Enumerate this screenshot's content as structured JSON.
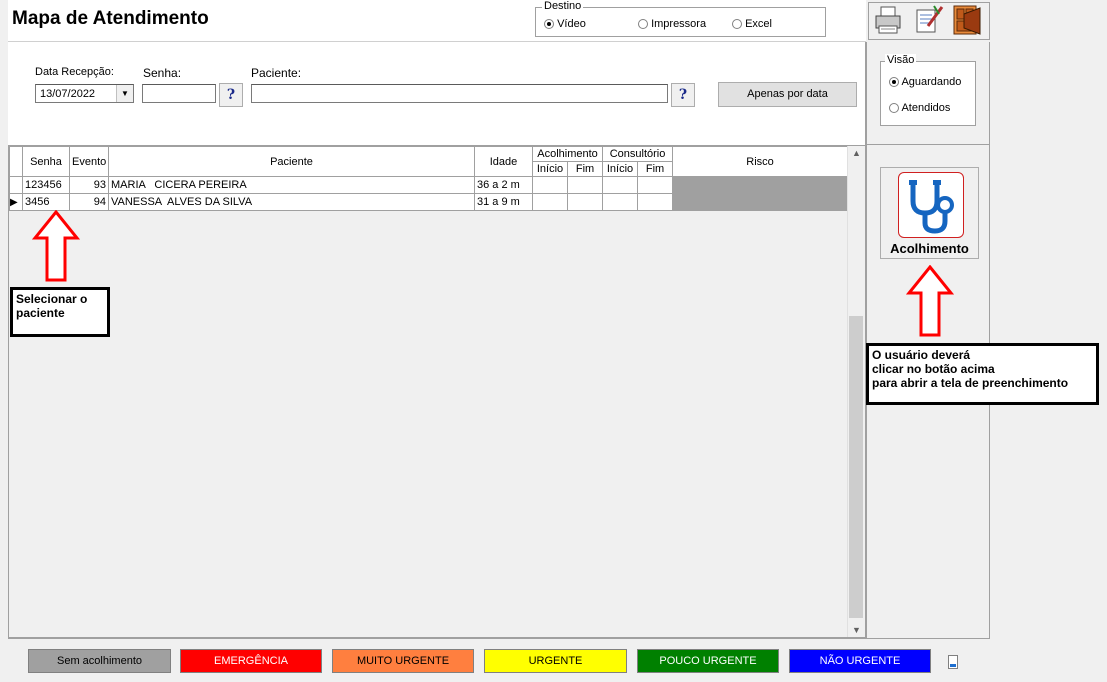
{
  "header": {
    "title": "Mapa de Atendimento",
    "destino": {
      "label": "Destino",
      "options": [
        "Vídeo",
        "Impressora",
        "Excel"
      ],
      "selected": "Vídeo"
    },
    "toolbar_icons": [
      "printer-icon",
      "edit-icon",
      "exit-door-icon"
    ]
  },
  "filters": {
    "data_label": "Data Recepção:",
    "data_value": "13/07/2022",
    "senha_label": "Senha:",
    "senha_value": "",
    "paciente_label": "Paciente:",
    "paciente_value": "",
    "help_glyph": "?",
    "apenas_label": "Apenas por data"
  },
  "visao": {
    "label": "Visão",
    "options": [
      "Aguardando",
      "Atendidos"
    ],
    "selected": "Aguardando"
  },
  "table": {
    "headers": {
      "senha": "Senha",
      "evento": "Evento",
      "paciente": "Paciente",
      "idade": "Idade",
      "acolhimento": "Acolhimento",
      "consultorio": "Consultório",
      "inicio": "Início",
      "fim": "Fim",
      "risco": "Risco"
    },
    "rows": [
      {
        "senha": "123456",
        "evento": "93",
        "paciente": "MARIA   CICERA PEREIRA",
        "idade": "36 a 2 m",
        "selected": false
      },
      {
        "senha": "3456",
        "evento": "94",
        "paciente": "VANESSA  ALVES DA SILVA",
        "idade": "31 a 9 m",
        "selected": true
      }
    ]
  },
  "acolhimento_button": {
    "label": "Acolhimento"
  },
  "annotations": {
    "select_patient": "Selecionar o paciente",
    "click_button_l1": "O usuário deverá",
    "click_button_l2": "clicar no botão acima",
    "click_button_l3": "para abrir a tela de preenchimento"
  },
  "legend": [
    {
      "label": "Sem acolhimento",
      "bg": "#a0a0a0",
      "fg": "#000000"
    },
    {
      "label": "EMERGÊNCIA",
      "bg": "#ff0000",
      "fg": "#ffffff"
    },
    {
      "label": "MUITO URGENTE",
      "bg": "#ff7f3f",
      "fg": "#000000"
    },
    {
      "label": "URGENTE",
      "bg": "#ffff00",
      "fg": "#000000"
    },
    {
      "label": "POUCO URGENTE",
      "bg": "#008000",
      "fg": "#ffffff"
    },
    {
      "label": "NÃO URGENTE",
      "bg": "#0000ff",
      "fg": "#ffffff"
    }
  ],
  "colors": {
    "risk_cell": "#a0a0a0",
    "annotation_arrow": "#ff0000"
  }
}
